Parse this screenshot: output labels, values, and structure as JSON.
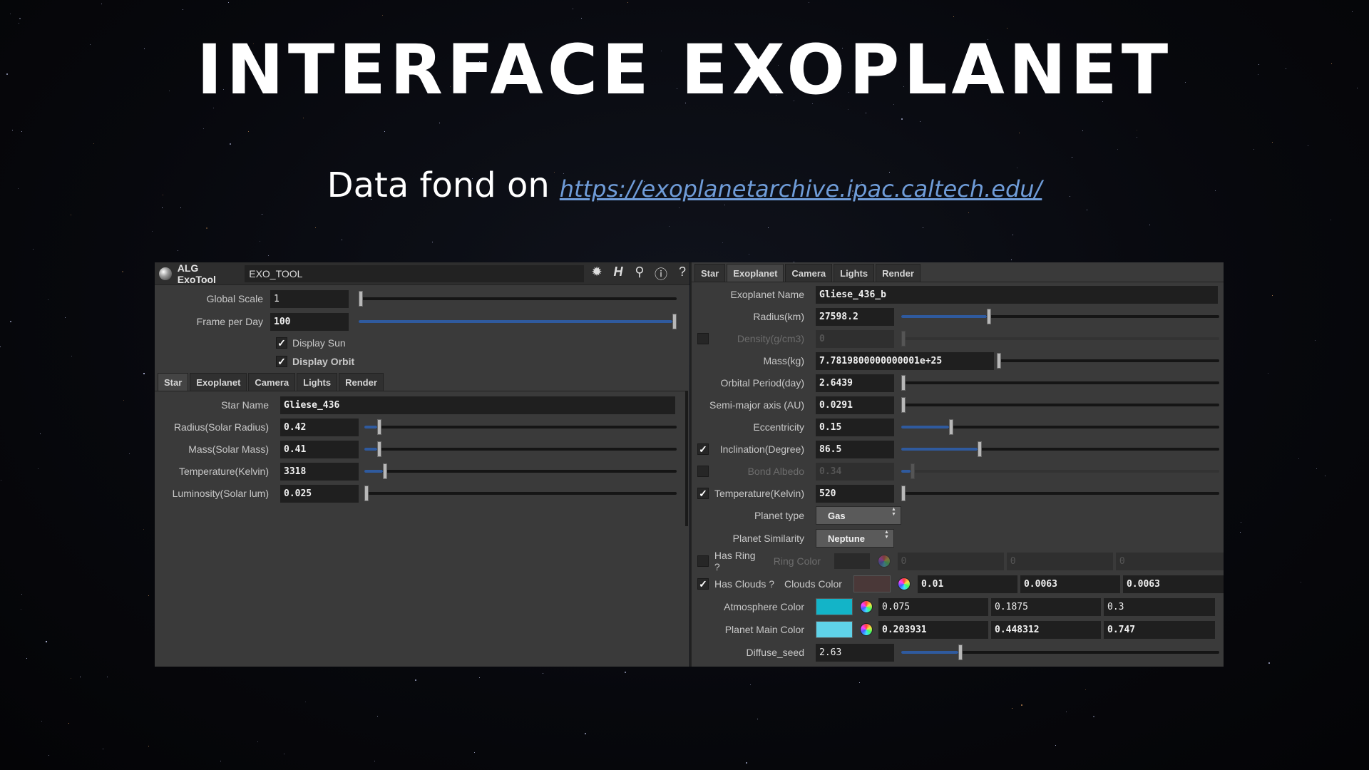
{
  "title": "INTERFACE EXOPLANET",
  "subtitle": {
    "text": "Data fond on",
    "link": "https://exoplanetarchive.ipac.caltech.edu/"
  },
  "left_panel": {
    "app_name": "ALG ExoTool",
    "node_name": "EXO_TOOL",
    "icons": [
      "gear-icon",
      "houdini-help-icon",
      "search-icon",
      "info-icon",
      "help-icon"
    ],
    "global_scale": {
      "label": "Global Scale",
      "value": "1",
      "level": 0.0
    },
    "frame_per_day": {
      "label": "Frame per Day",
      "value": "100",
      "level": 1.0
    },
    "display_sun": {
      "label": "Display Sun",
      "checked": true
    },
    "display_orbit": {
      "label": "Display Orbit",
      "checked": true
    },
    "tabs": [
      "Star",
      "Exoplanet",
      "Camera",
      "Lights",
      "Render"
    ],
    "star": {
      "name_label": "Star Name",
      "name_value": "Gliese_436",
      "params": [
        {
          "label": "Radius(Solar Radius)",
          "value": "0.42",
          "level": 0.04
        },
        {
          "label": "Mass(Solar Mass)",
          "value": "0.41",
          "level": 0.04
        },
        {
          "label": "Temperature(Kelvin)",
          "value": "3318",
          "level": 0.06
        },
        {
          "label": "Luminosity(Solar lum)",
          "value": "0.025",
          "level": 0.0
        }
      ]
    }
  },
  "right_panel": {
    "tabs": [
      "Star",
      "Exoplanet",
      "Camera",
      "Lights",
      "Render"
    ],
    "exoplanet_name_label": "Exoplanet Name",
    "exoplanet_name_value": "Gliese_436_b",
    "params": [
      {
        "label": "Radius(km)",
        "value": "27598.2",
        "level": 0.27,
        "enabled": true,
        "checkbox": null
      },
      {
        "label": "Density(g/cm3)",
        "value": "0",
        "level": 0.0,
        "enabled": false,
        "checkbox": false
      },
      {
        "label": "Mass(kg)",
        "value": "7.7819800000000001e+25",
        "level": 0.0,
        "enabled": true,
        "checkbox": null
      },
      {
        "label": "Orbital Period(day)",
        "value": "2.6439",
        "level": 0.0,
        "enabled": true,
        "checkbox": null
      },
      {
        "label": "Semi-major axis (AU)",
        "value": "0.0291",
        "level": 0.0,
        "enabled": true,
        "checkbox": null
      },
      {
        "label": "Eccentricity",
        "value": "0.15",
        "level": 0.15,
        "enabled": true,
        "checkbox": null
      },
      {
        "label": "Inclination(Degree)",
        "value": "86.5",
        "level": 0.24,
        "enabled": true,
        "checkbox": true
      },
      {
        "label": "Bond Albedo",
        "value": "0.34",
        "level": 0.03,
        "enabled": false,
        "checkbox": false
      },
      {
        "label": "Temperature(Kelvin)",
        "value": "520",
        "level": 0.0,
        "enabled": true,
        "checkbox": true
      }
    ],
    "planet_type": {
      "label": "Planet type",
      "value": "Gas"
    },
    "planet_similarity": {
      "label": "Planet Similarity",
      "value": "Neptune"
    },
    "has_ring": {
      "label": "Has Ring ?",
      "checked": false,
      "color_label": "Ring Color",
      "values": [
        "0",
        "0",
        "0"
      ],
      "swatch": "#2a2a2a"
    },
    "has_clouds": {
      "label": "Has Clouds ?",
      "checked": true,
      "color_label": "Clouds Color",
      "values": [
        "0.01",
        "0.0063",
        "0.0063"
      ],
      "swatch": "#4a3838"
    },
    "atmosphere_color": {
      "label": "Atmosphere Color",
      "values": [
        "0.075",
        "0.1875",
        "0.3"
      ],
      "swatch": "#13b4c8"
    },
    "planet_main_color": {
      "label": "Planet Main Color",
      "values": [
        "0.203931",
        "0.448312",
        "0.747"
      ],
      "swatch": "#5fd2e8"
    },
    "diffuse_seed": {
      "label": "Diffuse_seed",
      "value": "2.63",
      "level": 0.18
    }
  }
}
